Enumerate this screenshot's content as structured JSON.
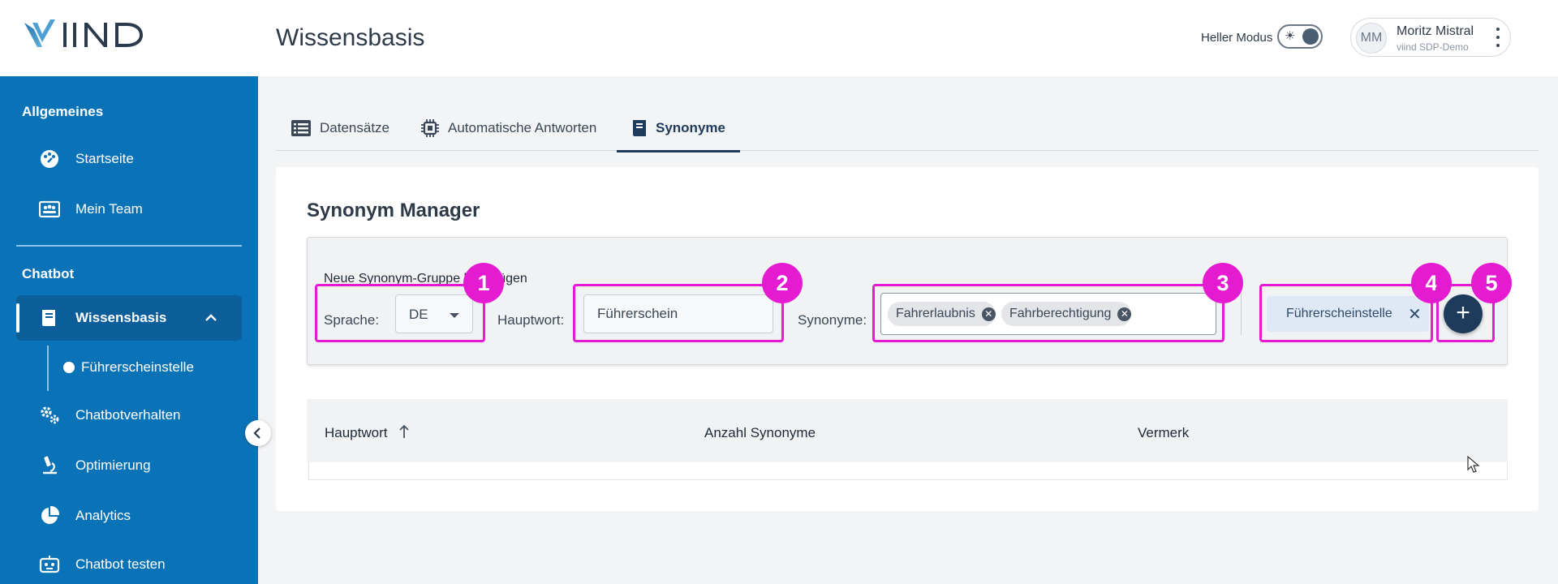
{
  "brand": {
    "logo_text": "VIIND"
  },
  "header": {
    "title": "Wissensbasis",
    "mode_label": "Heller Modus",
    "user": {
      "initials": "MM",
      "name": "Moritz Mistral",
      "org": "viind SDP-Demo"
    }
  },
  "sidebar": {
    "section_general": "Allgemeines",
    "items_general": [
      {
        "label": "Startseite",
        "icon": "palette-icon"
      },
      {
        "label": "Mein Team",
        "icon": "team-icon"
      }
    ],
    "section_chatbot": "Chatbot",
    "active_item": {
      "label": "Wissensbasis",
      "icon": "book-icon"
    },
    "sub_item": "Führerscheinstelle",
    "items_chatbot": [
      {
        "label": "Chatbotverhalten",
        "icon": "gears-icon"
      },
      {
        "label": "Optimierung",
        "icon": "microscope-icon"
      },
      {
        "label": "Analytics",
        "icon": "pie-chart-icon"
      },
      {
        "label": "Chatbot testen",
        "icon": "robot-icon"
      }
    ]
  },
  "tabs": [
    {
      "label": "Datensätze"
    },
    {
      "label": "Automatische Antworten"
    },
    {
      "label": "Synonyme"
    }
  ],
  "manager": {
    "title": "Synonym Manager",
    "form_heading": "Neue Synonym-Gruppe hinzufügen",
    "language_label": "Sprache:",
    "language_value": "DE",
    "noun_label": "Hauptwort:",
    "noun_value": "Führerschein",
    "synonyms_label": "Synonyme:",
    "synonyms": [
      "Fahrerlaubnis",
      "Fahrberechtigung"
    ],
    "tag": "Führerscheinstelle",
    "add_button": "+"
  },
  "annotations": [
    "1",
    "2",
    "3",
    "4",
    "5"
  ],
  "table": {
    "columns": [
      "Hauptwort",
      "Anzahl Synonyme",
      "Vermerk"
    ]
  },
  "colors": {
    "sidebar": "#0a73b7",
    "primary": "#1f3b5b",
    "highlight": "#e41bd1"
  }
}
